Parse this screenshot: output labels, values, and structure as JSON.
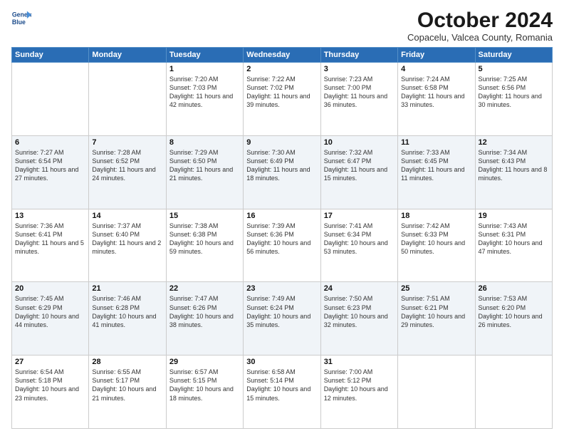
{
  "header": {
    "logo": {
      "line1": "General",
      "line2": "Blue"
    },
    "title": "October 2024",
    "subtitle": "Copacelu, Valcea County, Romania"
  },
  "days_of_week": [
    "Sunday",
    "Monday",
    "Tuesday",
    "Wednesday",
    "Thursday",
    "Friday",
    "Saturday"
  ],
  "weeks": [
    [
      {
        "day": "",
        "info": ""
      },
      {
        "day": "",
        "info": ""
      },
      {
        "day": "1",
        "info": "Sunrise: 7:20 AM\nSunset: 7:03 PM\nDaylight: 11 hours and 42 minutes."
      },
      {
        "day": "2",
        "info": "Sunrise: 7:22 AM\nSunset: 7:02 PM\nDaylight: 11 hours and 39 minutes."
      },
      {
        "day": "3",
        "info": "Sunrise: 7:23 AM\nSunset: 7:00 PM\nDaylight: 11 hours and 36 minutes."
      },
      {
        "day": "4",
        "info": "Sunrise: 7:24 AM\nSunset: 6:58 PM\nDaylight: 11 hours and 33 minutes."
      },
      {
        "day": "5",
        "info": "Sunrise: 7:25 AM\nSunset: 6:56 PM\nDaylight: 11 hours and 30 minutes."
      }
    ],
    [
      {
        "day": "6",
        "info": "Sunrise: 7:27 AM\nSunset: 6:54 PM\nDaylight: 11 hours and 27 minutes."
      },
      {
        "day": "7",
        "info": "Sunrise: 7:28 AM\nSunset: 6:52 PM\nDaylight: 11 hours and 24 minutes."
      },
      {
        "day": "8",
        "info": "Sunrise: 7:29 AM\nSunset: 6:50 PM\nDaylight: 11 hours and 21 minutes."
      },
      {
        "day": "9",
        "info": "Sunrise: 7:30 AM\nSunset: 6:49 PM\nDaylight: 11 hours and 18 minutes."
      },
      {
        "day": "10",
        "info": "Sunrise: 7:32 AM\nSunset: 6:47 PM\nDaylight: 11 hours and 15 minutes."
      },
      {
        "day": "11",
        "info": "Sunrise: 7:33 AM\nSunset: 6:45 PM\nDaylight: 11 hours and 11 minutes."
      },
      {
        "day": "12",
        "info": "Sunrise: 7:34 AM\nSunset: 6:43 PM\nDaylight: 11 hours and 8 minutes."
      }
    ],
    [
      {
        "day": "13",
        "info": "Sunrise: 7:36 AM\nSunset: 6:41 PM\nDaylight: 11 hours and 5 minutes."
      },
      {
        "day": "14",
        "info": "Sunrise: 7:37 AM\nSunset: 6:40 PM\nDaylight: 11 hours and 2 minutes."
      },
      {
        "day": "15",
        "info": "Sunrise: 7:38 AM\nSunset: 6:38 PM\nDaylight: 10 hours and 59 minutes."
      },
      {
        "day": "16",
        "info": "Sunrise: 7:39 AM\nSunset: 6:36 PM\nDaylight: 10 hours and 56 minutes."
      },
      {
        "day": "17",
        "info": "Sunrise: 7:41 AM\nSunset: 6:34 PM\nDaylight: 10 hours and 53 minutes."
      },
      {
        "day": "18",
        "info": "Sunrise: 7:42 AM\nSunset: 6:33 PM\nDaylight: 10 hours and 50 minutes."
      },
      {
        "day": "19",
        "info": "Sunrise: 7:43 AM\nSunset: 6:31 PM\nDaylight: 10 hours and 47 minutes."
      }
    ],
    [
      {
        "day": "20",
        "info": "Sunrise: 7:45 AM\nSunset: 6:29 PM\nDaylight: 10 hours and 44 minutes."
      },
      {
        "day": "21",
        "info": "Sunrise: 7:46 AM\nSunset: 6:28 PM\nDaylight: 10 hours and 41 minutes."
      },
      {
        "day": "22",
        "info": "Sunrise: 7:47 AM\nSunset: 6:26 PM\nDaylight: 10 hours and 38 minutes."
      },
      {
        "day": "23",
        "info": "Sunrise: 7:49 AM\nSunset: 6:24 PM\nDaylight: 10 hours and 35 minutes."
      },
      {
        "day": "24",
        "info": "Sunrise: 7:50 AM\nSunset: 6:23 PM\nDaylight: 10 hours and 32 minutes."
      },
      {
        "day": "25",
        "info": "Sunrise: 7:51 AM\nSunset: 6:21 PM\nDaylight: 10 hours and 29 minutes."
      },
      {
        "day": "26",
        "info": "Sunrise: 7:53 AM\nSunset: 6:20 PM\nDaylight: 10 hours and 26 minutes."
      }
    ],
    [
      {
        "day": "27",
        "info": "Sunrise: 6:54 AM\nSunset: 5:18 PM\nDaylight: 10 hours and 23 minutes."
      },
      {
        "day": "28",
        "info": "Sunrise: 6:55 AM\nSunset: 5:17 PM\nDaylight: 10 hours and 21 minutes."
      },
      {
        "day": "29",
        "info": "Sunrise: 6:57 AM\nSunset: 5:15 PM\nDaylight: 10 hours and 18 minutes."
      },
      {
        "day": "30",
        "info": "Sunrise: 6:58 AM\nSunset: 5:14 PM\nDaylight: 10 hours and 15 minutes."
      },
      {
        "day": "31",
        "info": "Sunrise: 7:00 AM\nSunset: 5:12 PM\nDaylight: 10 hours and 12 minutes."
      },
      {
        "day": "",
        "info": ""
      },
      {
        "day": "",
        "info": ""
      }
    ]
  ]
}
